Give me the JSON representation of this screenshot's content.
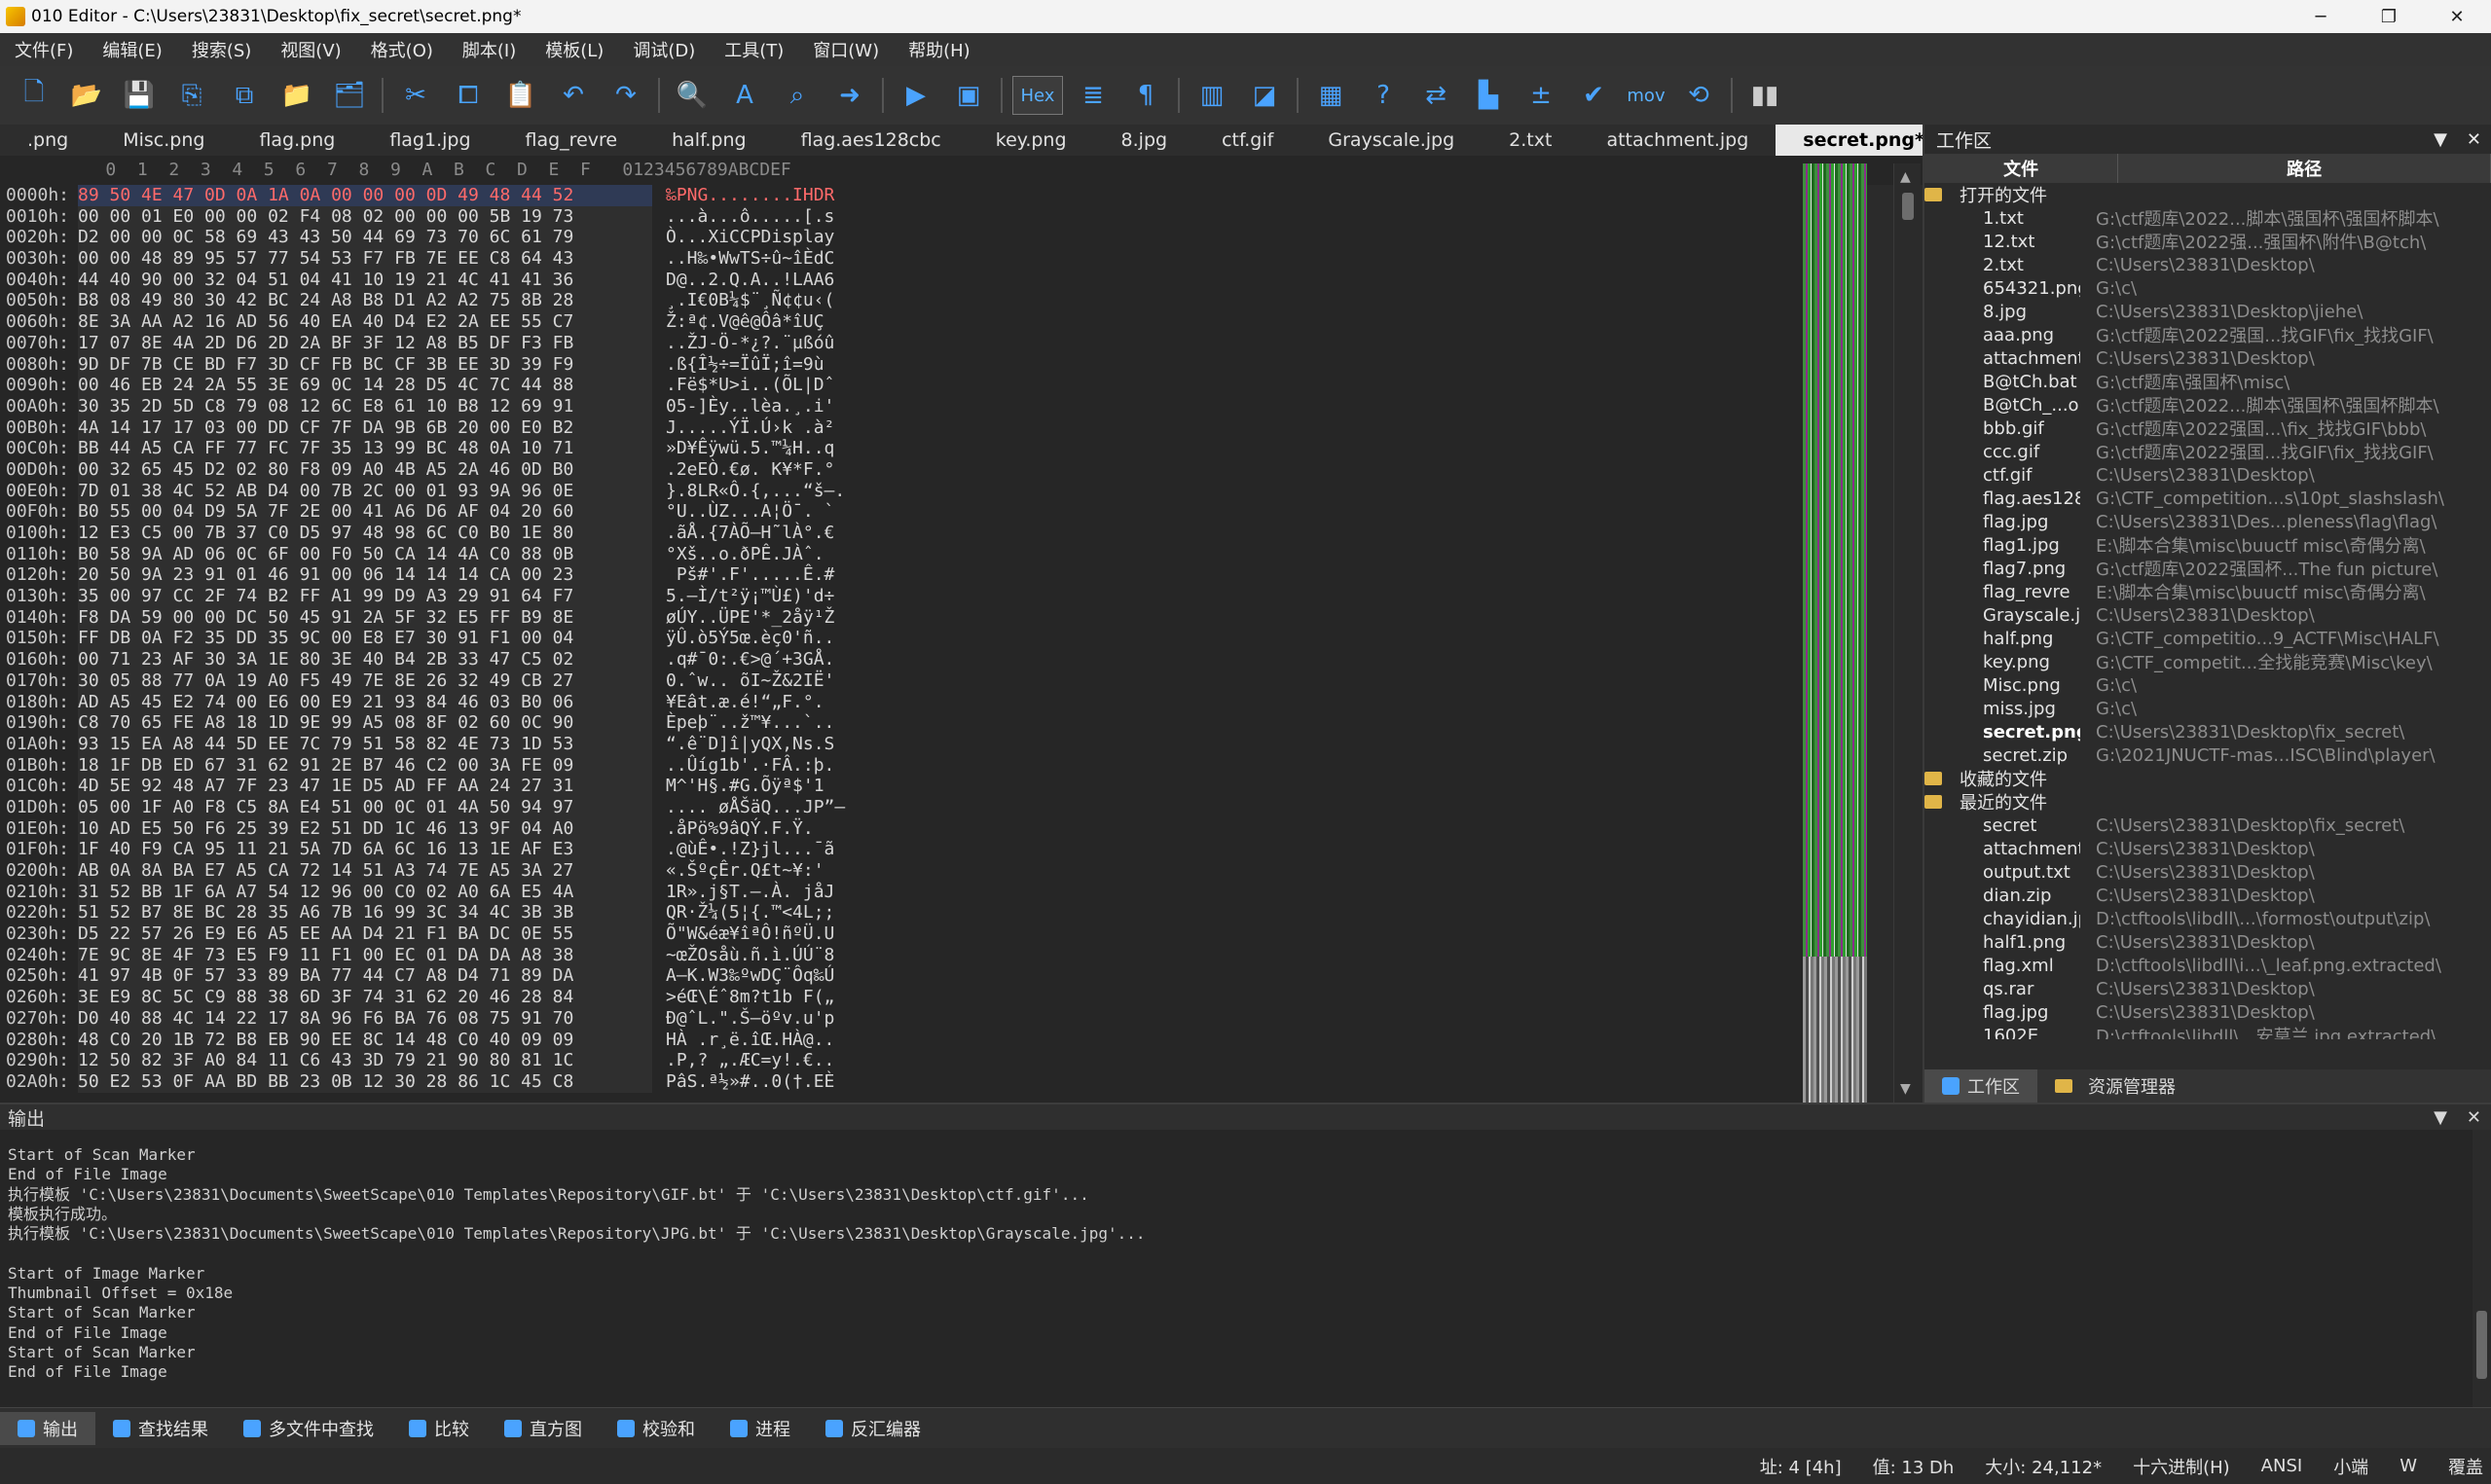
{
  "window": {
    "title": "010 Editor - C:\\Users\\23831\\Desktop\\fix_secret\\secret.png*",
    "min": "─",
    "max": "❐",
    "close": "✕"
  },
  "menu": [
    "文件(F)",
    "编辑(E)",
    "搜索(S)",
    "视图(V)",
    "格式(O)",
    "脚本(I)",
    "模板(L)",
    "调试(D)",
    "工具(T)",
    "窗口(W)",
    "帮助(H)"
  ],
  "toolbar": {
    "hex_label": "Hex",
    "mov_label": "mov",
    "icons": [
      "new-file-icon",
      "open-file-icon",
      "save-icon",
      "save-as-icon",
      "save-all-icon",
      "open-folder-icon",
      "open-drive-icon",
      "cut-icon",
      "copy-icon",
      "paste-icon",
      "undo-icon",
      "redo-icon",
      "find-icon",
      "replace-icon",
      "find-in-files-icon",
      "goto-icon",
      "run-script-icon",
      "run-template-icon",
      "hex-icon",
      "text-mode-icon",
      "pilcrow-icon",
      "columns-icon",
      "select-icon",
      "calculator-icon",
      "checksum-icon",
      "compare-icon",
      "histogram-icon",
      "operations-icon",
      "validate-icon",
      "mov-icon",
      "convert-icon",
      "pause-icon"
    ]
  },
  "tabs": [
    ".png",
    "Misc.png",
    "flag.png",
    "flag1.jpg",
    "flag_revre",
    "half.png",
    "flag.aes128cbc",
    "key.png",
    "8.jpg",
    "ctf.gif",
    "Grayscale.jpg",
    "2.txt",
    "attachment.jpg",
    "secret.png*"
  ],
  "tab_close": "✕",
  "hex": {
    "header": "          0  1  2  3  4  5  6  7  8  9  A  B  C  D  E  F   0123456789ABCDEF",
    "rows": [
      {
        "a": "0000h:",
        "b": "89 50 4E 47 0D 0A 1A 0A 00 00 00 0D 49 48 44 52",
        "t": "‰PNG........IHDR"
      },
      {
        "a": "0010h:",
        "b": "00 00 01 E0 00 00 02 F4 08 02 00 00 00 5B 19 73",
        "t": "...à...ô.....[.s"
      },
      {
        "a": "0020h:",
        "b": "D2 00 00 0C 58 69 43 43 50 44 69 73 70 6C 61 79",
        "t": "Ò...XiCCPDisplay"
      },
      {
        "a": "0030h:",
        "b": "00 00 48 89 95 57 77 54 53 F7 FB 7E EE C8 64 43",
        "t": "..H‰•WwTS÷û~îÈdC"
      },
      {
        "a": "0040h:",
        "b": "44 40 90 00 32 04 51 04 41 10 19 21 4C 41 41 36",
        "t": "D@..2.Q.A..!LAA6"
      },
      {
        "a": "0050h:",
        "b": "B8 08 49 80 30 42 BC 24 A8 B8 D1 A2 A2 75 8B 28",
        "t": "¸.I€0B¼$¨¸Ñ¢¢u‹("
      },
      {
        "a": "0060h:",
        "b": "8E 3A AA A2 16 AD 56 40 EA 40 D4 E2 2A EE 55 C7",
        "t": "Ž:ª¢.­V@ê@Ôâ*îUÇ"
      },
      {
        "a": "0070h:",
        "b": "17 07 8E 4A 2D D6 2D 2A BF 3F 12 A8 B5 DF F3 FB",
        "t": "..ŽJ-Ö-*¿?.¨µßóû"
      },
      {
        "a": "0080h:",
        "b": "9D DF 7B CE BD F7 3D CF FB BC CF 3B EE 3D 39 F9",
        "t": ".ß{Î½÷=ÏûÏ;î=9ù"
      },
      {
        "a": "0090h:",
        "b": "00 46 EB 24 2A 55 3E 69 0C 14 28 D5 4C 7C 44 88",
        "t": ".Fë$*U>i..(ÕL|Dˆ"
      },
      {
        "a": "00A0h:",
        "b": "30 35 2D 5D C8 79 08 12 6C E8 61 10 B8 12 69 91",
        "t": "05-]Èy..lèa.¸.i'"
      },
      {
        "a": "00B0h:",
        "b": "4A 14 17 17 03 00 DD CF 7F DA 9B 6B 20 00 E0 B2",
        "t": "J.....ÝÏ.Ú›k .à²"
      },
      {
        "a": "00C0h:",
        "b": "BB 44 A5 CA FF 77 FC 7F 35 13 99 BC 48 0A 10 71",
        "t": "»D¥Êÿwü.5.™¼H..q"
      },
      {
        "a": "00D0h:",
        "b": "00 32 65 45 D2 02 80 F8 09 A0 4B A5 2A 46 0D B0",
        "t": ".2eEÒ.€ø. K¥*F.°"
      },
      {
        "a": "00E0h:",
        "b": "7D 01 38 4C 52 AB D4 00 7B 2C 00 01 93 9A 96 0E",
        "t": "}.8LR«Ô.{,...“š–."
      },
      {
        "a": "00F0h:",
        "b": "B0 55 00 04 D9 5A 7F 2E 00 41 A6 D6 AF 04 20 60",
        "t": "°U..ÙZ.‌..A¦Ö¯. `"
      },
      {
        "a": "0100h:",
        "b": "12 E3 C5 00 7B 37 C0 D5 97 48 98 6C C0 B0 1E 80",
        "t": ".ãÅ.{7ÀÕ—H˜lÀ°.€"
      },
      {
        "a": "0110h:",
        "b": "B0 58 9A AD 06 0C 6F 00 F0 50 CA 14 4A C0 88 0B",
        "t": "°Xš­..o.ðPÊ.JÀˆ."
      },
      {
        "a": "0120h:",
        "b": "20 50 9A 23 91 01 46 91 00 06 14 14 14 CA 00 23",
        "t": " Pš#'.F'.....Ê.#"
      },
      {
        "a": "0130h:",
        "b": "35 00 97 CC 2F 74 B2 FF A1 99 D9 A3 29 91 64 F7",
        "t": "5.—Ì/t²ÿ¡™Ù£)'d÷"
      },
      {
        "a": "0140h:",
        "b": "F8 DA 59 00 00 DC 50 45 91 2A 5F 32 E5 FF B9 8E",
        "t": "øÚY..ÜPE'*_2åÿ¹Ž"
      },
      {
        "a": "0150h:",
        "b": "FF DB 0A F2 35 DD 35 9C 00 E8 E7 30 91 F1 00 04",
        "t": "ÿÛ.ò5Ý5œ.èç0'ñ.."
      },
      {
        "a": "0160h:",
        "b": "00 71 23 AF 30 3A 1E 80 3E 40 B4 2B 33 47 C5 02",
        "t": ".q#¯0:.€>@´+3GÅ."
      },
      {
        "a": "0170h:",
        "b": "30 05 88 77 0A 19 A0 F5 49 7E 8E 26 32 49 CB 27",
        "t": "0.ˆw.. õI~Ž&2IË'"
      },
      {
        "a": "0180h:",
        "b": "AD A5 45 E2 74 00 E6 00 E9 21 93 84 46 03 B0 06",
        "t": "­¥Eât.æ.é!“„F.°."
      },
      {
        "a": "0190h:",
        "b": "C8 70 65 FE A8 18 1D 9E 99 A5 08 8F 02 60 0C 90",
        "t": "Èpeþ¨..ž™¥...`.."
      },
      {
        "a": "01A0h:",
        "b": "93 15 EA A8 44 5D EE 7C 79 51 58 82 4E 73 1D 53",
        "t": "“.ê¨D]î|yQX‚Ns.S"
      },
      {
        "a": "01B0h:",
        "b": "18 1F DB ED 67 31 62 91 2E B7 46 C2 00 3A FE 09",
        "t": "..Ûíg1b'.·FÂ.:þ."
      },
      {
        "a": "01C0h:",
        "b": "4D 5E 92 48 A7 7F 23 47 1E D5 AD FF AA 24 27 31",
        "t": "M^'H§.#G.Õ­ÿª$'1"
      },
      {
        "a": "01D0h:",
        "b": "05 00 1F A0 F8 C5 8A E4 51 00 0C 01 4A 50 94 97",
        "t": ".... øÅŠäQ...JP”—"
      },
      {
        "a": "01E0h:",
        "b": "10 AD E5 50 F6 25 39 E2 51 DD 1C 46 13 9F 04 A0",
        "t": ".­åPö%9âQÝ.F.Ÿ. "
      },
      {
        "a": "01F0h:",
        "b": "1F 40 F9 CA 95 11 21 5A 7D 6A 6C 16 13 1E AF E3",
        "t": ".@ùÊ•.!Z}jl...¯ã"
      },
      {
        "a": "0200h:",
        "b": "AB 0A 8A BA E7 A5 CA 72 14 51 A3 74 7E A5 3A 27",
        "t": "«.ŠºçÊr.Q£t~¥:'"
      },
      {
        "a": "0210h:",
        "b": "31 52 BB 1F 6A A7 54 12 96 00 C0 02 A0 6A E5 4A",
        "t": "1R».j§T.–.À. jåJ"
      },
      {
        "a": "0220h:",
        "b": "51 52 B7 8E BC 28 35 A6 7B 16 99 3C 34 4C 3B 3B",
        "t": "QR·Ž¼(5¦{.™<4L;;"
      },
      {
        "a": "0230h:",
        "b": "D5 22 57 26 E9 E6 A5 EE AA D4 21 F1 BA DC 0E 55",
        "t": "Õ\"W&éæ¥îªÔ!ñºÜ.U"
      },
      {
        "a": "0240h:",
        "b": "7E 9C 8E 4F 73 E5 F9 11 F1 00 EC 01 DA DA A8 38",
        "t": "~œŽOsåù.ñ.ì.ÚÚ¨8"
      },
      {
        "a": "0250h:",
        "b": "41 97 4B 0F 57 33 89 BA 77 44 C7 A8 D4 71 89 DA",
        "t": "A—K.W3‰ºwDÇ¨Ôq‰Ú"
      },
      {
        "a": "0260h:",
        "b": "3E E9 8C 5C C9 88 38 6D 3F 74 31 62 20 46 28 84",
        "t": ">éŒ\\Éˆ8m?t1b F(„"
      },
      {
        "a": "0270h:",
        "b": "D0 40 88 4C 14 22 17 8A 96 F6 BA 76 08 75 91 70",
        "t": "Ð@ˆL.\".Š–öºv.u'p"
      },
      {
        "a": "0280h:",
        "b": "48 C0 20 1B 72 B8 EB 90 EE 8C 14 48 C0 40 09 09",
        "t": "HÀ .r¸ë.îŒ.HÀ@.."
      },
      {
        "a": "0290h:",
        "b": "12 50 82 3F A0 84 11 C6 43 3D 79 21 90 80 81 1C",
        "t": ".P‚? „.ÆC=y!.€.."
      },
      {
        "a": "02A0h:",
        "b": "50 E2 53 0F AA BD BB 23 0B 12 30 28 86 1C 45 C8",
        "t": "PâS.ª½»#..0(†.EÈ"
      }
    ]
  },
  "workspace": {
    "title": "工作区",
    "col_file": "文件",
    "col_path": "路径",
    "open_group": "打开的文件",
    "open_files": [
      {
        "n": "1.txt",
        "p": "G:\\ctf题库\\2022...脚本\\强国杯\\强国杯脚本\\"
      },
      {
        "n": "12.txt",
        "p": "G:\\ctf题库\\2022强...强国杯\\附件\\B@tch\\"
      },
      {
        "n": "2.txt",
        "p": "C:\\Users\\23831\\Desktop\\"
      },
      {
        "n": "654321.png",
        "p": "G:\\c\\"
      },
      {
        "n": "8.jpg",
        "p": "C:\\Users\\23831\\Desktop\\jiehe\\"
      },
      {
        "n": "aaa.png",
        "p": "G:\\ctf题库\\2022强国...找GIF\\fix_找找GIF\\"
      },
      {
        "n": "attachment.jpg",
        "p": "C:\\Users\\23831\\Desktop\\"
      },
      {
        "n": "B@tCh.bat",
        "p": "G:\\ctf题库\\强国杯\\misc\\"
      },
      {
        "n": "B@tCh_...on.bat",
        "p": "G:\\ctf题库\\2022...脚本\\强国杯\\强国杯脚本\\"
      },
      {
        "n": "bbb.gif",
        "p": "G:\\ctf题库\\2022强国...\\fix_找找GIF\\bbb\\"
      },
      {
        "n": "ccc.gif",
        "p": "G:\\ctf题库\\2022强国...找GIF\\fix_找找GIF\\"
      },
      {
        "n": "ctf.gif",
        "p": "C:\\Users\\23831\\Desktop\\"
      },
      {
        "n": "flag.aes128cbc",
        "p": "G:\\CTF_competition...s\\10pt_slashslash\\"
      },
      {
        "n": "flag.jpg",
        "p": "C:\\Users\\23831\\Des...pleness\\flag\\flag\\"
      },
      {
        "n": "flag1.jpg",
        "p": "E:\\脚本合集\\misc\\buuctf misc\\奇偶分离\\"
      },
      {
        "n": "flag7.png",
        "p": "G:\\ctf题库\\2022强国杯...The fun picture\\"
      },
      {
        "n": "flag_revre",
        "p": "E:\\脚本合集\\misc\\buuctf misc\\奇偶分离\\"
      },
      {
        "n": "Grayscale.jpg",
        "p": "C:\\Users\\23831\\Desktop\\"
      },
      {
        "n": "half.png",
        "p": "G:\\CTF_competitio...9_ACTF\\Misc\\HALF\\"
      },
      {
        "n": "key.png",
        "p": "G:\\CTF_competit...全找能竞赛\\Misc\\key\\"
      },
      {
        "n": "Misc.png",
        "p": "G:\\c\\"
      },
      {
        "n": "miss.jpg",
        "p": "G:\\c\\"
      },
      {
        "n": "secret.png*",
        "p": "C:\\Users\\23831\\Desktop\\fix_secret\\",
        "bold": true
      },
      {
        "n": "secret.zip",
        "p": "G:\\2021JNUCTF-mas...ISC\\Blind\\player\\"
      }
    ],
    "fav_group": "收藏的文件",
    "recent_group": "最近的文件",
    "recent_files": [
      {
        "n": "secret",
        "p": "C:\\Users\\23831\\Desktop\\fix_secret\\"
      },
      {
        "n": "attachment",
        "p": "C:\\Users\\23831\\Desktop\\"
      },
      {
        "n": "output.txt",
        "p": "C:\\Users\\23831\\Desktop\\"
      },
      {
        "n": "dian.zip",
        "p": "C:\\Users\\23831\\Desktop\\"
      },
      {
        "n": "chayidian.jpg",
        "p": "D:\\ctftools\\libdll\\...\\formost\\output\\zip\\"
      },
      {
        "n": "half1.png",
        "p": "C:\\Users\\23831\\Desktop\\"
      },
      {
        "n": "flag.xml",
        "p": "D:\\ctftools\\libdll\\i...\\_leaf.png.extracted\\"
      },
      {
        "n": "qs.rar",
        "p": "C:\\Users\\23831\\Desktop\\"
      },
      {
        "n": "flag.jpg",
        "p": "C:\\Users\\23831\\Desktop\\"
      },
      {
        "n": "1602E",
        "p": "D:\\ctftools\\libdll\\...安莫兰.jpg.extracted\\"
      }
    ],
    "tab_workspace": "工作区",
    "tab_explorer": "资源管理器"
  },
  "output": {
    "title": "输出",
    "lines": [
      "Start of Scan Marker",
      "End of File Image",
      "执行模板 'C:\\Users\\23831\\Documents\\SweetScape\\010 Templates\\Repository\\GIF.bt' 于 'C:\\Users\\23831\\Desktop\\ctf.gif'...",
      "模板执行成功。",
      "执行模板 'C:\\Users\\23831\\Documents\\SweetScape\\010 Templates\\Repository\\JPG.bt' 于 'C:\\Users\\23831\\Desktop\\Grayscale.jpg'...",
      "",
      "Start of Image Marker",
      "Thumbnail Offset = 0x18e",
      "Start of Scan Marker",
      "End of File Image",
      "Start of Scan Marker",
      "End of File Image"
    ]
  },
  "bottom_tabs": [
    "输出",
    "查找结果",
    "多文件中查找",
    "比较",
    "直方图",
    "校验和",
    "进程",
    "反汇编器"
  ],
  "status": {
    "addr": "址: 4 [4h]",
    "value": "值: 13 Dh",
    "size": "大小: 24,112*",
    "mode": "十六进制(H)",
    "enc": "ANSI",
    "endian": "小端",
    "w": "W",
    "ovr": "覆盖"
  }
}
